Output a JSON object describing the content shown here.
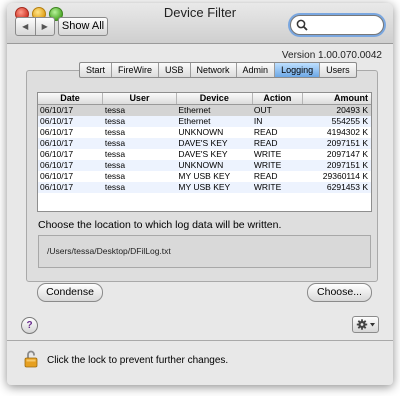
{
  "window": {
    "title": "Device Filter"
  },
  "toolbar": {
    "back_glyph": "◀",
    "forward_glyph": "▶",
    "show_all_label": "Show All"
  },
  "search": {
    "value": "",
    "placeholder": ""
  },
  "version_text": "Version 1.00.070.0042",
  "tabs": [
    {
      "label": "Start",
      "active": false
    },
    {
      "label": "FireWire",
      "active": false
    },
    {
      "label": "USB",
      "active": false
    },
    {
      "label": "Network",
      "active": false
    },
    {
      "label": "Admin",
      "active": false
    },
    {
      "label": "Logging",
      "active": true
    },
    {
      "label": "Users",
      "active": false
    }
  ],
  "table": {
    "columns": [
      "Date",
      "User",
      "Device",
      "Action",
      "Amount"
    ],
    "rows": [
      [
        "06/10/17",
        "tessa",
        "Ethernet",
        "OUT",
        "20493 K"
      ],
      [
        "06/10/17",
        "tessa",
        "Ethernet",
        "IN",
        "554255 K"
      ],
      [
        "06/10/17",
        "tessa",
        "UNKNOWN",
        "READ",
        "4194302 K"
      ],
      [
        "06/10/17",
        "tessa",
        "DAVE'S KEY",
        "READ",
        "2097151 K"
      ],
      [
        "06/10/17",
        "tessa",
        "DAVE'S KEY",
        "WRITE",
        "2097147 K"
      ],
      [
        "06/10/17",
        "tessa",
        "UNKNOWN",
        "WRITE",
        "2097151 K"
      ],
      [
        "06/10/17",
        "tessa",
        "MY USB KEY",
        "READ",
        "29360114 K"
      ],
      [
        "06/10/17",
        "tessa",
        "MY USB KEY",
        "WRITE",
        "6291453 K"
      ]
    ],
    "selected_row": 0
  },
  "log_location": {
    "prompt": "Choose the location to which log data will be written.",
    "path": "/Users/tessa/Desktop/DFilLog.txt"
  },
  "buttons": {
    "condense_label": "Condense",
    "choose_label": "Choose..."
  },
  "help_glyph": "?",
  "lock_message": "Click the lock to prevent further changes.",
  "icons": {
    "search": "search-icon",
    "help": "help-icon",
    "gear": "gear-icon",
    "lock": "lock-open-icon"
  },
  "colors": {
    "active_tab": "#6da8e6",
    "alt_row": "#edf3fe",
    "selected_row": "#d4d4d4",
    "search_focus": "#7aa7e0"
  }
}
